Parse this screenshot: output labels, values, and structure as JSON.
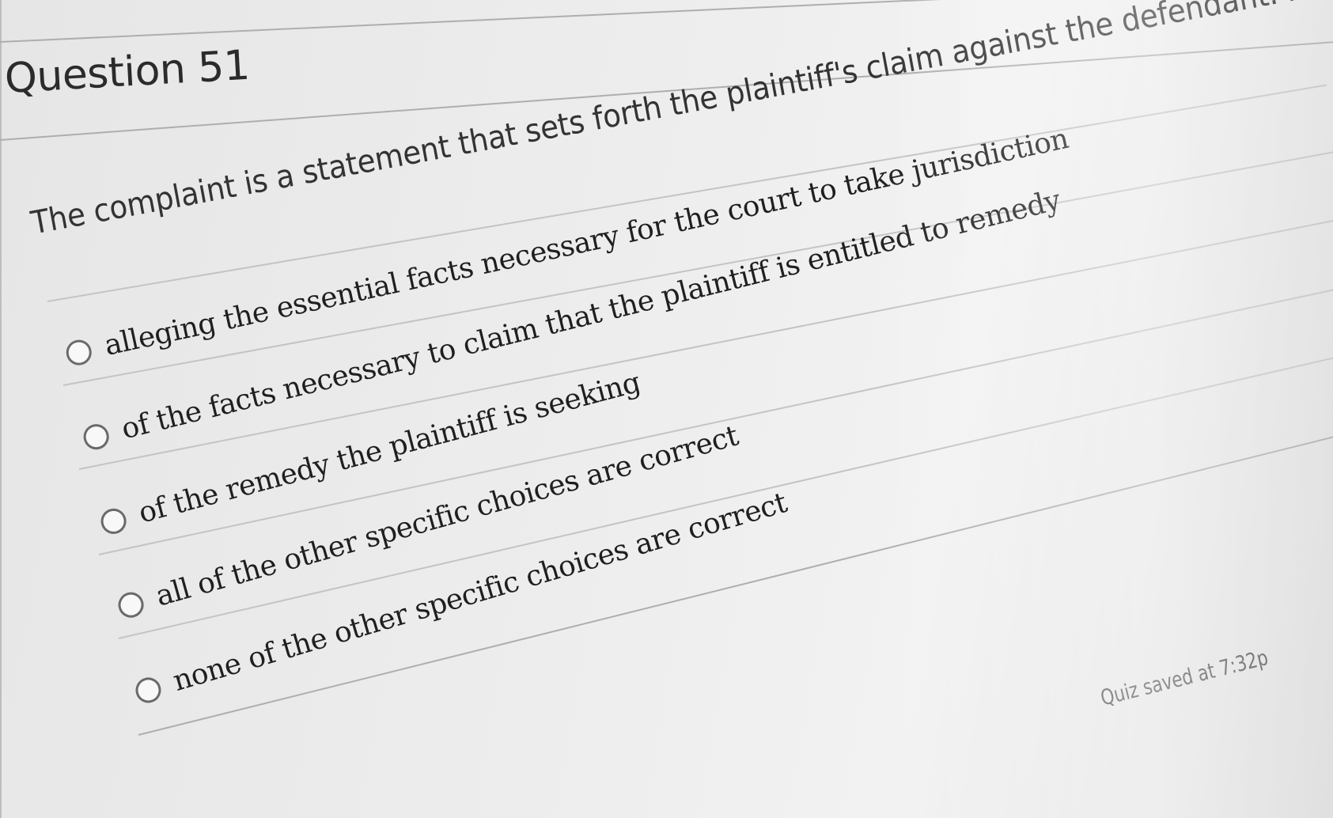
{
  "question": {
    "title": "Question 51",
    "text": "The complaint is a statement that sets forth the plaintiff's claim against the defendant. It contains statements:"
  },
  "answers": [
    {
      "label": "alleging the essential facts necessary for the court to take jurisdiction",
      "selected": false
    },
    {
      "label": "of the facts necessary to claim that the plaintiff is entitled to remedy",
      "selected": false
    },
    {
      "label": "of the remedy the plaintiff is seeking",
      "selected": false
    },
    {
      "label": "all of the other specific choices are correct",
      "selected": false
    },
    {
      "label": "none of the other specific choices are correct",
      "selected": false
    }
  ],
  "footer": {
    "status": "Quiz saved at 7:32p"
  }
}
